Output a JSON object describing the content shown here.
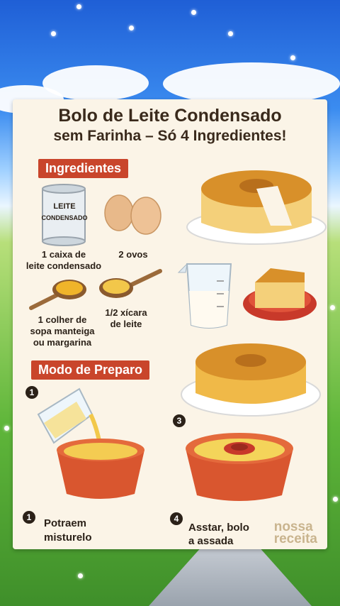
{
  "title": {
    "line1": "Bolo de Leite Condensado",
    "line2": "sem Farinha – Só 4 Ingredientes!"
  },
  "sections": {
    "ingredients": "Ingredientes",
    "preparation": "Modo de Preparo"
  },
  "can_label": {
    "line1": "LEITE",
    "line2": "CONDENSADO"
  },
  "ingredients": [
    {
      "label_line1": "1 caixa de",
      "label_line2": "leite condensado"
    },
    {
      "label_line1": "2 ovos"
    },
    {
      "label_line1": "1 colher de",
      "label_line2": "sopa manteiga",
      "label_line3": "ou margarina"
    },
    {
      "label_line1": "1/2 xícara",
      "label_line2": "de leite"
    }
  ],
  "steps": [
    {
      "number": "1",
      "number_bottom": "1",
      "text_line1": "Potraem",
      "text_line2": "misturelo"
    },
    {
      "number": "3",
      "number_bottom": "4",
      "text_line1": "Asstar, bolo",
      "text_line2": "a assada"
    }
  ],
  "watermark": {
    "line1": "nossa",
    "line2": "receita"
  },
  "colors": {
    "accent": "#c9452b",
    "cake": "#f2bf4a",
    "bowl": "#d9562f"
  }
}
